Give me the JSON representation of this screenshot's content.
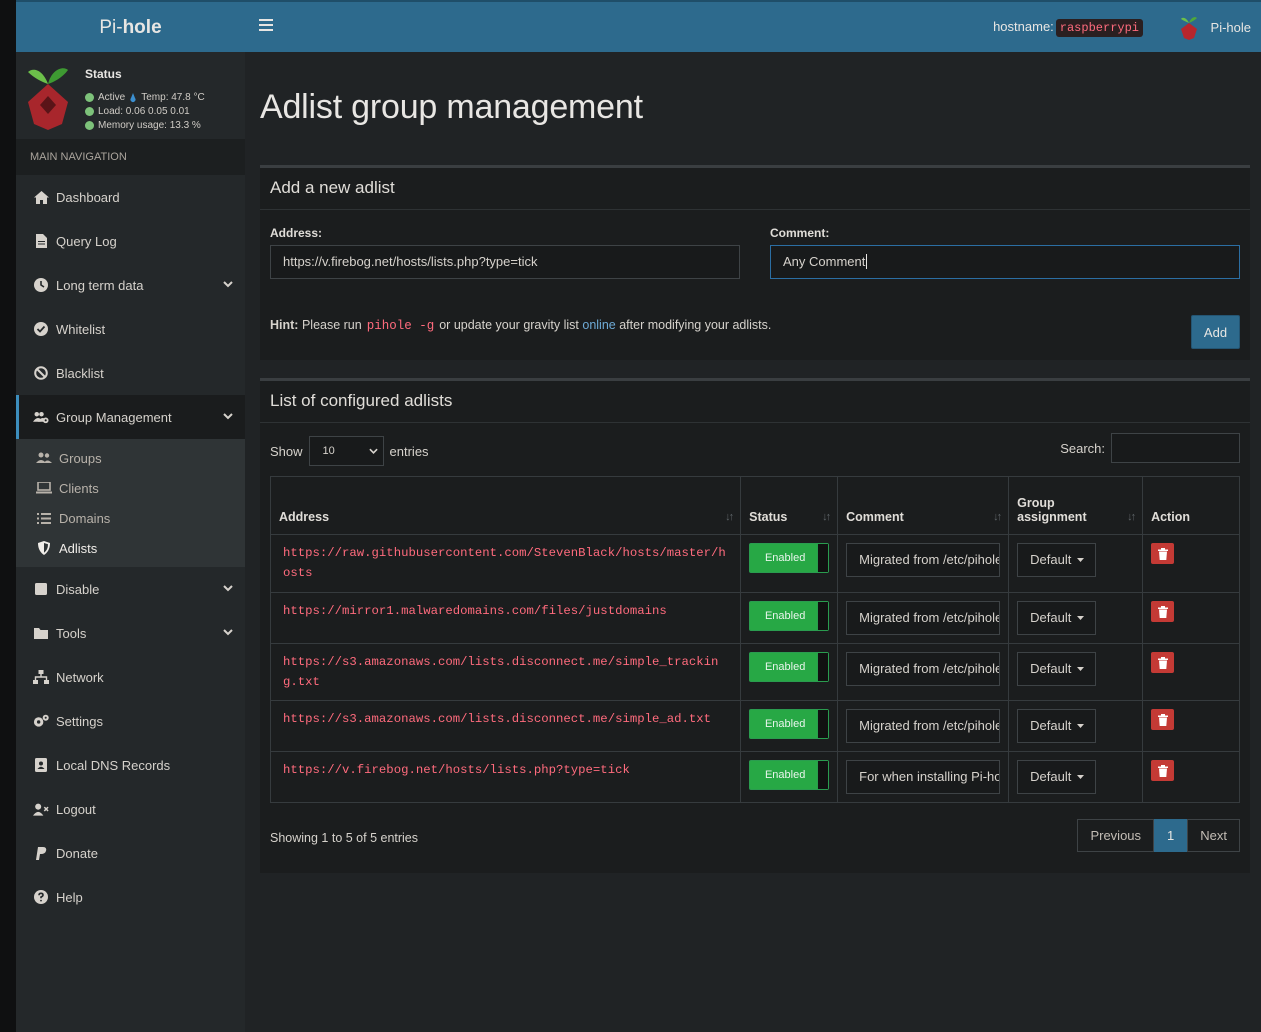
{
  "app": {
    "logo_pre": "Pi-",
    "logo_bold": "hole",
    "hostname_label": "hostname:",
    "hostname": "raspberrypi",
    "user": "Pi-hole"
  },
  "status": {
    "title": "Status",
    "active": "Active",
    "temp": "Temp: 47.8 °C",
    "load": "Load:  0.06  0.05  0.01",
    "memory": "Memory usage:  13.3 %"
  },
  "nav": {
    "header": "MAIN NAVIGATION",
    "items": [
      {
        "label": "Dashboard",
        "icon": "home-icon"
      },
      {
        "label": "Query Log",
        "icon": "file-icon"
      },
      {
        "label": "Long term data",
        "icon": "clock-icon"
      },
      {
        "label": "Whitelist",
        "icon": "check-circle-icon"
      },
      {
        "label": "Blacklist",
        "icon": "ban-icon"
      },
      {
        "label": "Group Management",
        "icon": "users-cog-icon"
      },
      {
        "label": "Disable",
        "icon": "stop-icon"
      },
      {
        "label": "Tools",
        "icon": "folder-icon"
      },
      {
        "label": "Network",
        "icon": "network-icon"
      },
      {
        "label": "Settings",
        "icon": "cogs-icon"
      },
      {
        "label": "Local DNS Records",
        "icon": "address-book-icon"
      },
      {
        "label": "Logout",
        "icon": "user-times-icon"
      },
      {
        "label": "Donate",
        "icon": "paypal-icon"
      },
      {
        "label": "Help",
        "icon": "question-circle-icon"
      }
    ],
    "sub": [
      {
        "label": "Groups",
        "icon": "user-friends-icon"
      },
      {
        "label": "Clients",
        "icon": "laptop-icon"
      },
      {
        "label": "Domains",
        "icon": "list-icon"
      },
      {
        "label": "Adlists",
        "icon": "shield-icon"
      }
    ]
  },
  "page": {
    "title": "Adlist group management"
  },
  "add": {
    "title": "Add a new adlist",
    "address_label": "Address:",
    "address_value": "https://v.firebog.net/hosts/lists.php?type=tick",
    "comment_label": "Comment:",
    "comment_value": "Any Comment",
    "hint_label": "Hint:",
    "hint_text1": "Please run",
    "hint_code": "pihole -g",
    "hint_text2": "or update your gravity list",
    "hint_link": "online",
    "hint_text3": "after modifying your adlists.",
    "add_button": "Add"
  },
  "list": {
    "title": "List of configured adlists",
    "show": "Show",
    "entries_value": "10",
    "entries": "entries",
    "search_label": "Search:",
    "columns": {
      "address": "Address",
      "status": "Status",
      "comment": "Comment",
      "group": "Group assignment",
      "action": "Action"
    },
    "rows": [
      {
        "address": "https://raw.githubusercontent.com/StevenBlack/hosts/master/hosts",
        "status": "Enabled",
        "comment": "Migrated from /etc/pihole/adlists.list",
        "group": "Default"
      },
      {
        "address": "https://mirror1.malwaredomains.com/files/justdomains",
        "status": "Enabled",
        "comment": "Migrated from /etc/pihole/adlists.list",
        "group": "Default"
      },
      {
        "address": "https://s3.amazonaws.com/lists.disconnect.me/simple_tracking.txt",
        "status": "Enabled",
        "comment": "Migrated from /etc/pihole/adlists.list",
        "group": "Default"
      },
      {
        "address": "https://s3.amazonaws.com/lists.disconnect.me/simple_ad.txt",
        "status": "Enabled",
        "comment": "Migrated from /etc/pihole/adlists.list",
        "group": "Default"
      },
      {
        "address": "https://v.firebog.net/hosts/lists.php?type=tick",
        "status": "Enabled",
        "comment": "For when installing Pi-hole",
        "group": "Default"
      }
    ],
    "info": "Showing 1 to 5 of 5 entries",
    "pager": {
      "prev": "Previous",
      "current": "1",
      "next": "Next"
    }
  }
}
